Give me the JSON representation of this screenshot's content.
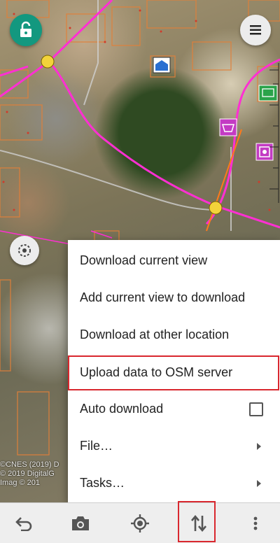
{
  "map": {
    "attribution_lines": [
      "©CNES (2019) D",
      "© 2019 DigitalG",
      "Imag      © 201"
    ]
  },
  "icons": {
    "lock": "unlocked-lock-icon",
    "menu": "hamburger-menu-icon",
    "gps": "gps-target-icon",
    "undo": "undo-icon",
    "camera": "camera-icon",
    "locate": "my-location-icon",
    "transfer": "upload-download-icon",
    "more": "more-vertical-icon"
  },
  "popup_menu": {
    "items": [
      {
        "label": "Download current view"
      },
      {
        "label": "Add current view to download"
      },
      {
        "label": "Download at other location"
      },
      {
        "label": "Upload data to OSM server"
      },
      {
        "label": "Auto download"
      },
      {
        "label": "File…"
      },
      {
        "label": "Tasks…"
      }
    ],
    "auto_download_checked": false,
    "highlighted_item": "Upload data to OSM server"
  },
  "colors": {
    "accent_teal": "#13987f",
    "highlight_red": "#d9272e",
    "osm_road": "#ff2fd3"
  }
}
